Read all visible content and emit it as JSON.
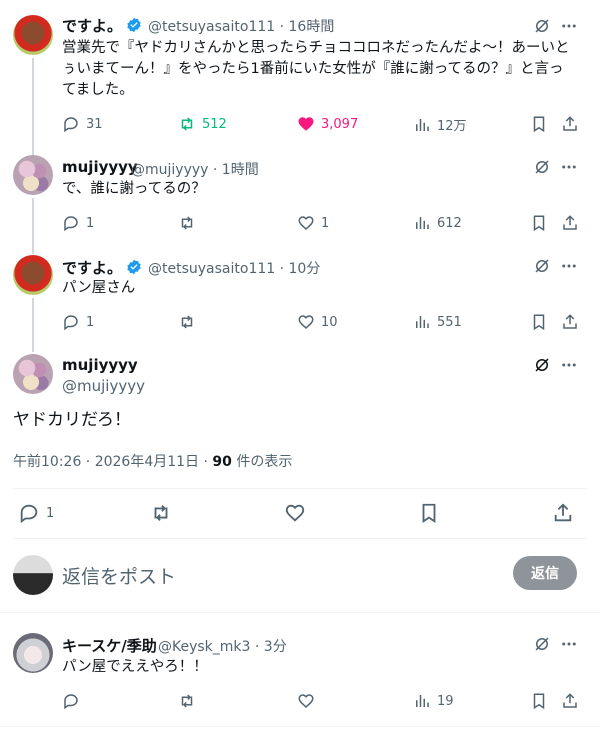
{
  "tweets": [
    {
      "name": "ですよ。",
      "handle": "@tetsuyasaito111 · 16時間",
      "text": "営業先で『ヤドカリさんかと思ったらチョココロネだったんだよ〜！あーいとぅいまてーん！』をやったら1番前にいた女性が『誰に謝ってるの？』と言ってました。",
      "replies": "31",
      "retweets": "512",
      "likes": "3,097",
      "views": "12万"
    },
    {
      "name": "mujiyyyy",
      "handle": "@mujiyyyy · 1時間",
      "text": "で、誰に謝ってるの？",
      "replies": "1",
      "retweets": "",
      "likes": "1",
      "views": "612"
    },
    {
      "name": "ですよ。",
      "handle": "@tetsuyasaito111 · 10分",
      "text": "パン屋さん",
      "replies": "1",
      "retweets": "",
      "likes": "10",
      "views": "551"
    }
  ],
  "main_tweet": {
    "name": "mujiyyyy",
    "handle": "@mujiyyyy",
    "text": "ヤドカリだろ！",
    "timestamp": "午前10:26 · 2026年4月11日 · ",
    "views_count": "90",
    "views_suffix": " 件の表示",
    "replies": "1"
  },
  "compose": {
    "placeholder": "返信をポスト",
    "button_label": "返信"
  },
  "reply_tweet": {
    "name": "キースケ/季助",
    "handle": "@Keysk_mk3 · 3分",
    "text": "パン屋でええやろ！！",
    "views": "19"
  },
  "colors": {
    "verified": "#1d9bf0",
    "retweet": "#00ba7c",
    "like": "#f91880",
    "reply_button": "#8e9499"
  },
  "icons": [
    "verified-icon",
    "grok-icon",
    "more-icon",
    "reply-icon",
    "retweet-icon",
    "like-icon",
    "views-icon",
    "bookmark-icon",
    "share-icon"
  ]
}
